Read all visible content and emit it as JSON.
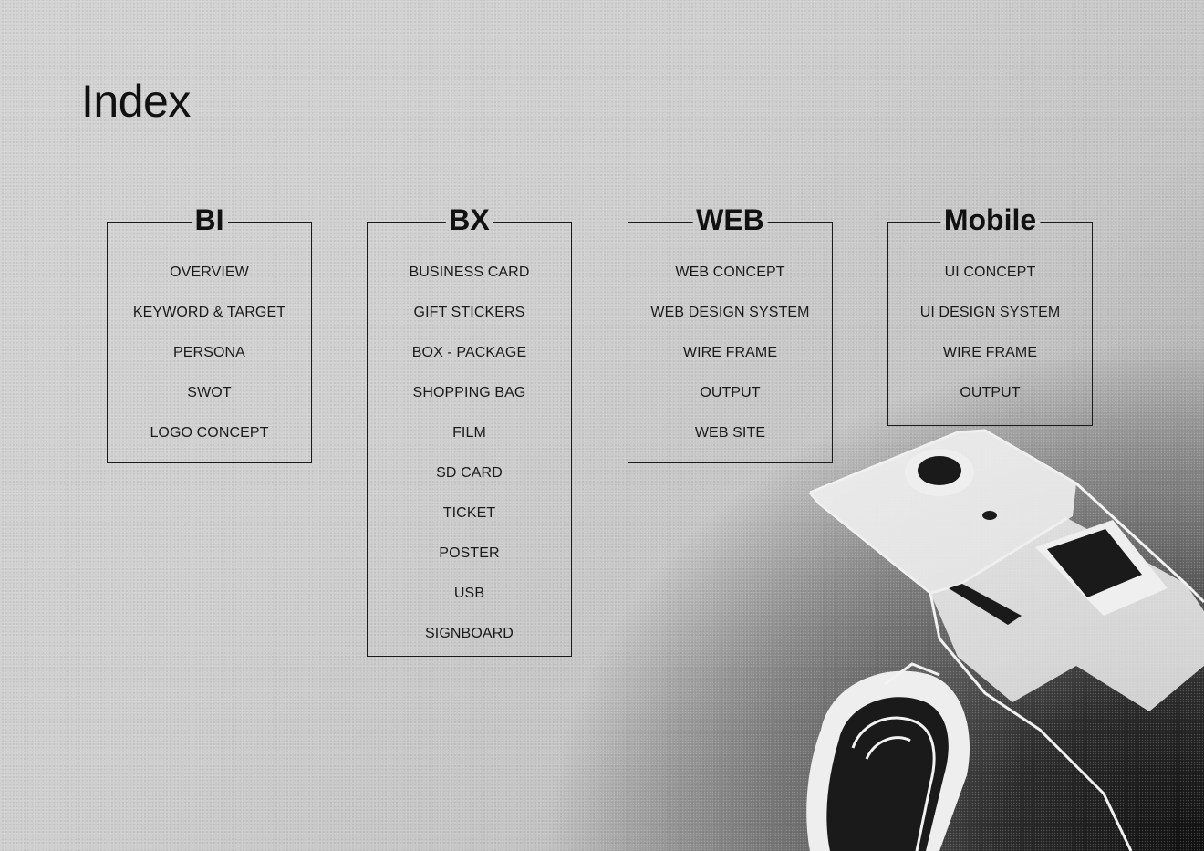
{
  "page": {
    "title": "Index"
  },
  "sections": [
    {
      "title": "BI",
      "items": [
        "OVERVIEW",
        "KEYWORD & TARGET",
        "PERSONA",
        "SWOT",
        "LOGO CONCEPT"
      ]
    },
    {
      "title": "BX",
      "items": [
        "BUSINESS CARD",
        "GIFT STICKERS",
        "BOX - PACKAGE",
        "SHOPPING BAG",
        "FILM",
        "SD CARD",
        "TICKET",
        "POSTER",
        "USB",
        "SIGNBOARD"
      ]
    },
    {
      "title": "WEB",
      "items": [
        "WEB CONCEPT",
        "WEB DESIGN SYSTEM",
        "WIRE FRAME",
        "OUTPUT",
        "WEB SITE"
      ]
    },
    {
      "title": "Mobile",
      "items": [
        "UI CONCEPT",
        "UI DESIGN SYSTEM",
        "WIRE FRAME",
        "OUTPUT"
      ]
    }
  ],
  "decoration": {
    "image": "camera-illustration"
  }
}
